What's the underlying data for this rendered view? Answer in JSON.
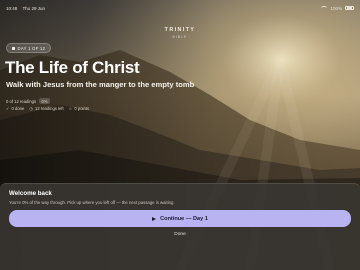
{
  "status_bar": {
    "time": "10:48",
    "date": "Thu 29 Jun",
    "battery": "100%"
  },
  "brand": {
    "line1": "TRINITY",
    "line2": "BIBLE"
  },
  "day_pill": {
    "label": "DAY 1 OF 12"
  },
  "plan": {
    "title": "The Life of Christ",
    "subtitle": "Walk with Jesus from the manger to the empty tomb",
    "readings_label": "0 of 12 readings",
    "percent_badge": "0%",
    "done_label": "0 done",
    "left_label": "12 readings left",
    "points_label": "0 points"
  },
  "resume_panel": {
    "title": "Welcome back",
    "message": "You're 0% of the way through. Pick up where you left off — the next passage is waiting.",
    "continue_label": "Continue — Day 1",
    "done_label": "Done"
  },
  "progress": {
    "percent": 0
  },
  "colors": {
    "accent": "#b9b3f2",
    "panel": "#3a3732"
  }
}
